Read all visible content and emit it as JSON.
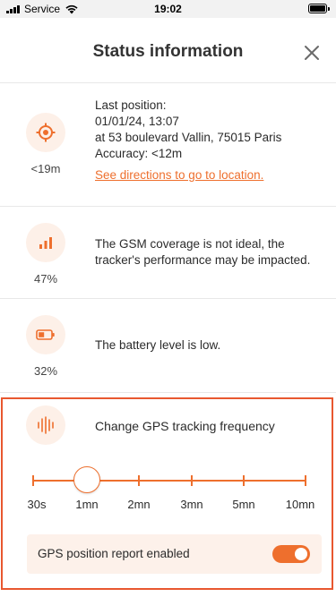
{
  "status_bar": {
    "carrier": "Service",
    "time": "19:02"
  },
  "header": {
    "title": "Status information",
    "close_icon": "close-icon"
  },
  "position": {
    "icon": "location-target-icon",
    "value": "<19m",
    "line1": "Last position:",
    "line2": "01/01/24, 13:07",
    "line3": "at 53 boulevard Vallin, 75015 Paris",
    "line4": "Accuracy: <12m",
    "link": "See directions to go to location."
  },
  "gsm": {
    "icon": "signal-bars-icon",
    "value": "47%",
    "text_line1": "The GSM coverage is not ideal, the",
    "text_line2": "tracker's performance may be impacted."
  },
  "battery": {
    "icon": "battery-low-icon",
    "value": "32%",
    "text": "The battery level is low."
  },
  "frequency": {
    "icon": "sound-wave-icon",
    "title": "Change GPS tracking frequency",
    "options": [
      "30s",
      "1mn",
      "2mn",
      "3mn",
      "5mn",
      "10mn"
    ],
    "selected": "1mn",
    "report_label": "GPS position report enabled",
    "report_enabled": true
  },
  "colors": {
    "accent": "#ee6f2d",
    "highlight_border": "#e8572f",
    "icon_bg": "#fdf0e8"
  }
}
